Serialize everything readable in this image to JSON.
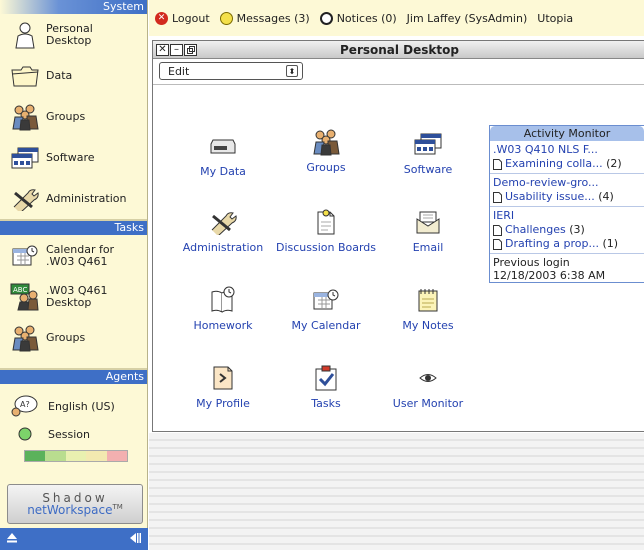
{
  "sidebar": {
    "system_header": "System",
    "system_items": [
      {
        "label_line1": "Personal",
        "label_line2": "Desktop",
        "icon": "person-icon"
      },
      {
        "label_line1": "Data",
        "label_line2": "",
        "icon": "folder-icon"
      },
      {
        "label_line1": "Groups",
        "label_line2": "",
        "icon": "groups-icon"
      },
      {
        "label_line1": "Software",
        "label_line2": "",
        "icon": "software-icon"
      },
      {
        "label_line1": "Administration",
        "label_line2": "",
        "icon": "tools-icon"
      }
    ],
    "tasks_header": "Tasks",
    "task_items": [
      {
        "label_line1": "Calendar for",
        "label_line2": ".W03 Q461",
        "icon": "calendar-icon"
      },
      {
        "label_line1": ".W03 Q461",
        "label_line2": "Desktop",
        "icon": "abc-desktop-icon"
      },
      {
        "label_line1": "Groups",
        "label_line2": "",
        "icon": "groups-icon"
      }
    ],
    "agents_header": "Agents",
    "language": "English (US)",
    "session_label": "Session",
    "session_colors": [
      "#5bb25b",
      "#b9dd8f",
      "#e9f0b0",
      "#f3e9b0",
      "#f3b0b0"
    ]
  },
  "brand": {
    "line1": "Shadow",
    "line2": "netWorkspace",
    "tm": "TM"
  },
  "topbar": {
    "logout": "Logout",
    "messages": "Messages (3)",
    "notices": "Notices (0)",
    "user": "Jim Laffey (SysAdmin)",
    "org": "Utopia"
  },
  "window": {
    "title": "Personal Desktop",
    "edit_value": "Edit",
    "icons": [
      {
        "label": "My Data",
        "icon": "drive-icon"
      },
      {
        "label": "Groups",
        "icon": "groups-icon"
      },
      {
        "label": "Software",
        "icon": "software-icon"
      },
      {
        "label": "Administration",
        "icon": "tools-icon"
      },
      {
        "label": "Discussion Boards",
        "icon": "discussion-icon"
      },
      {
        "label": "Email",
        "icon": "email-icon"
      },
      {
        "label": "Homework",
        "icon": "homework-icon"
      },
      {
        "label": "My Calendar",
        "icon": "calendar-icon"
      },
      {
        "label": "My Notes",
        "icon": "notes-icon"
      },
      {
        "label": "My Profile",
        "icon": "profile-icon"
      },
      {
        "label": "Tasks",
        "icon": "tasks-icon"
      },
      {
        "label": "User Monitor",
        "icon": "eye-icon"
      }
    ]
  },
  "activity": {
    "title": "Activity Monitor",
    "groups": [
      {
        "name": ".W03 Q410 NLS F...",
        "items": [
          {
            "text": "Examining colla...",
            "count": "(2)"
          }
        ]
      },
      {
        "name": "Demo-review-gro...",
        "items": [
          {
            "text": "Usability issue...",
            "count": "(4)"
          }
        ]
      },
      {
        "name": "IERI",
        "items": [
          {
            "text": "Challenges",
            "count": "(3)"
          },
          {
            "text": "Drafting a prop...",
            "count": "(1)"
          }
        ]
      }
    ],
    "last_login_label": "Previous login",
    "last_login_value": "12/18/2003 6:38 AM"
  }
}
